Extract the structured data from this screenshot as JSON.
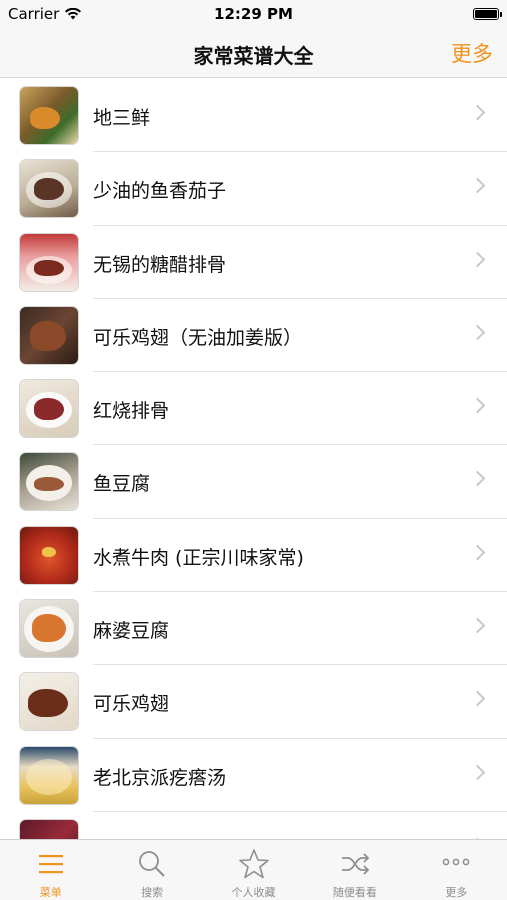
{
  "status_bar": {
    "carrier": "Carrier",
    "time": "12:29 PM"
  },
  "nav": {
    "title": "家常菜谱大全",
    "more_label": "更多"
  },
  "recipes": [
    {
      "name": "地三鲜"
    },
    {
      "name": "少油的鱼香茄子"
    },
    {
      "name": "无锡的糖醋排骨"
    },
    {
      "name": "可乐鸡翅（无油加姜版）"
    },
    {
      "name": "红烧排骨"
    },
    {
      "name": "鱼豆腐"
    },
    {
      "name": "水煮牛肉 (正宗川味家常)"
    },
    {
      "name": "麻婆豆腐"
    },
    {
      "name": "可乐鸡翅"
    },
    {
      "name": "老北京派疙瘩汤"
    },
    {
      "name": ""
    }
  ],
  "tabs": [
    {
      "label": "菜单",
      "icon": "menu-icon",
      "active": true
    },
    {
      "label": "搜索",
      "icon": "search-icon",
      "active": false
    },
    {
      "label": "个人收藏",
      "icon": "star-icon",
      "active": false
    },
    {
      "label": "随便看看",
      "icon": "shuffle-icon",
      "active": false
    },
    {
      "label": "更多",
      "icon": "more-dots-icon",
      "active": false
    }
  ],
  "colors": {
    "accent": "#f0931c",
    "tab_inactive": "#8e8e93"
  }
}
